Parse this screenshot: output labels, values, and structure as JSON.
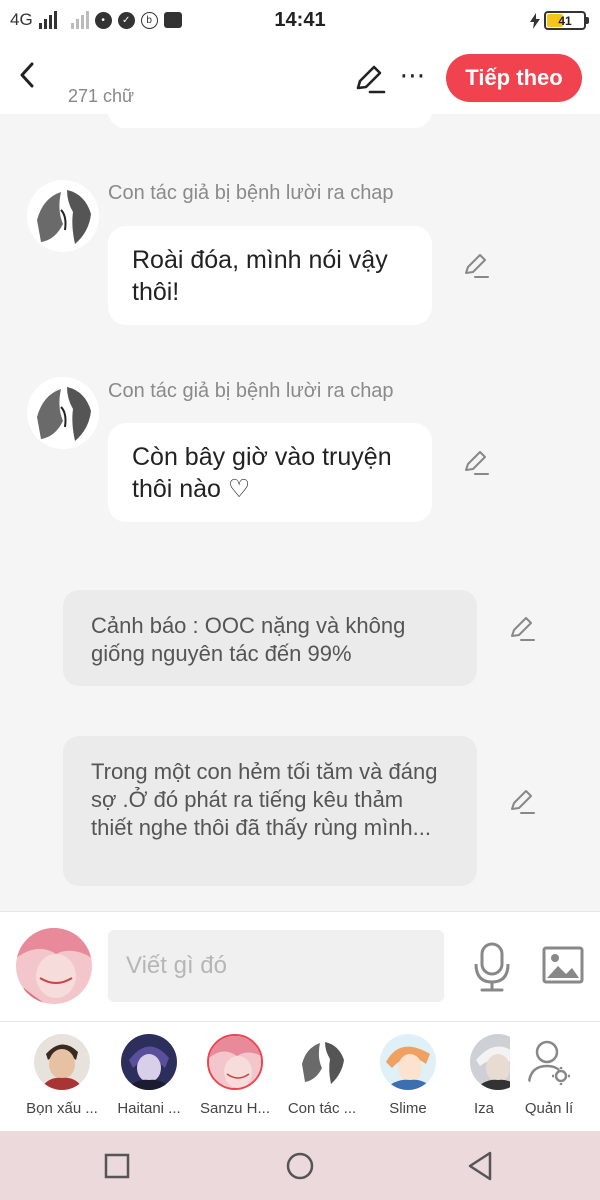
{
  "status_bar": {
    "network": "4G",
    "time": "14:41",
    "battery": "41"
  },
  "header": {
    "word_count": "271 chữ",
    "next_label": "Tiếp theo"
  },
  "chat": {
    "messages": [
      {
        "character": "Con tác giả bị bệnh lười ra chap",
        "text": "Roài đóa,  mình nói vậy thôi!"
      },
      {
        "character": "Con tác giả bị bệnh lười ra chap",
        "text": "Còn bây giờ vào truyện thôi nào ♡"
      }
    ],
    "narrations": [
      {
        "text": "Cảnh báo : OOC nặng và không giống nguyên tác đến 99%"
      },
      {
        "text": "Trong một con hẻm tối tăm và đáng sợ  .Ở đó phát ra tiếng kêu thảm thiết nghe thôi đã thấy rùng mình..."
      }
    ]
  },
  "composer": {
    "placeholder": "Viết gì đó"
  },
  "characters": [
    {
      "label": "Bọn xấu ..."
    },
    {
      "label": "Haitani ..."
    },
    {
      "label": "Sanzu H..."
    },
    {
      "label": "Con tác ..."
    },
    {
      "label": "Slime"
    },
    {
      "label": "Iza"
    },
    {
      "label": "Quản lí"
    }
  ],
  "colors": {
    "accent": "#f0434f",
    "navbar": "#ecd9db"
  }
}
